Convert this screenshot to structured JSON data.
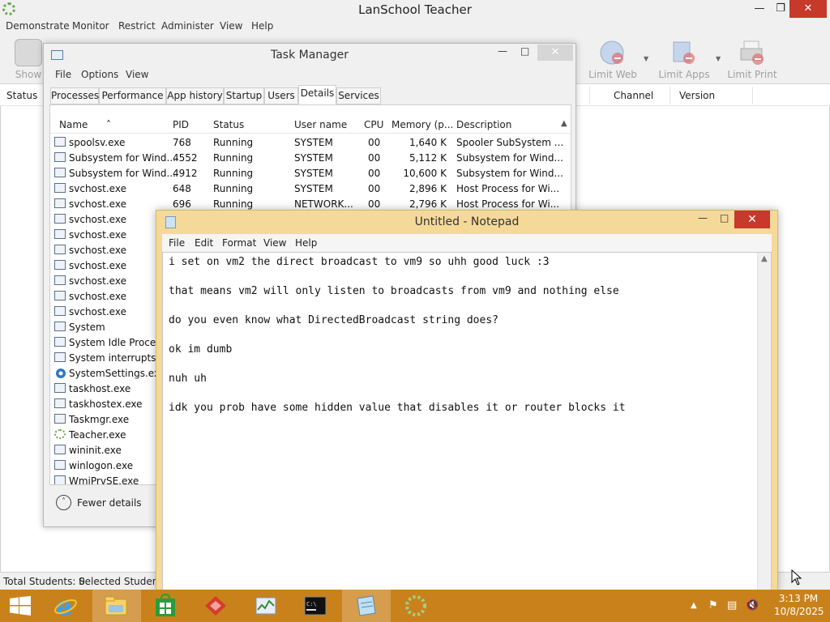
{
  "lanschool": {
    "title": "LanSchool Teacher",
    "menu": [
      "Demonstrate",
      "Monitor",
      "Restrict",
      "Administer",
      "View",
      "Help"
    ],
    "toolbar": {
      "show_label": "Show",
      "limit_web": "Limit Web",
      "limit_apps": "Limit Apps",
      "limit_print": "Limit Print"
    },
    "columns": {
      "status": "Status",
      "channel": "Channel",
      "version": "Version"
    },
    "statusbar": {
      "total": "Total Students: 0",
      "selected": "Selected Students:"
    }
  },
  "taskmgr": {
    "title": "Task Manager",
    "menu": [
      "File",
      "Options",
      "View"
    ],
    "tabs": [
      "Processes",
      "Performance",
      "App history",
      "Startup",
      "Users",
      "Details",
      "Services"
    ],
    "active_tab": "Details",
    "columns": [
      "Name",
      "PID",
      "Status",
      "User name",
      "CPU",
      "Memory (p...",
      "Description"
    ],
    "rows": [
      {
        "name": "spoolsv.exe",
        "pid": "768",
        "status": "Running",
        "user": "SYSTEM",
        "cpu": "00",
        "mem": "1,640 K",
        "desc": "Spooler SubSystem ..."
      },
      {
        "name": "Subsystem for Wind...",
        "pid": "4552",
        "status": "Running",
        "user": "SYSTEM",
        "cpu": "00",
        "mem": "5,112 K",
        "desc": "Subsystem for Wind..."
      },
      {
        "name": "Subsystem for Wind...",
        "pid": "4912",
        "status": "Running",
        "user": "SYSTEM",
        "cpu": "00",
        "mem": "10,600 K",
        "desc": "Subsystem for Wind..."
      },
      {
        "name": "svchost.exe",
        "pid": "648",
        "status": "Running",
        "user": "SYSTEM",
        "cpu": "00",
        "mem": "2,896 K",
        "desc": "Host Process for Wi..."
      },
      {
        "name": "svchost.exe",
        "pid": "696",
        "status": "Running",
        "user": "NETWORK...",
        "cpu": "00",
        "mem": "2,796 K",
        "desc": "Host Process for Wi..."
      },
      {
        "name": "svchost.exe"
      },
      {
        "name": "svchost.exe"
      },
      {
        "name": "svchost.exe"
      },
      {
        "name": "svchost.exe"
      },
      {
        "name": "svchost.exe"
      },
      {
        "name": "svchost.exe"
      },
      {
        "name": "svchost.exe"
      },
      {
        "name": "System"
      },
      {
        "name": "System Idle Process"
      },
      {
        "name": "System interrupts"
      },
      {
        "name": "SystemSettings.exe",
        "icon": "gear-icon"
      },
      {
        "name": "taskhost.exe"
      },
      {
        "name": "taskhostex.exe"
      },
      {
        "name": "Taskmgr.exe"
      },
      {
        "name": "Teacher.exe",
        "icon": "lanschool-icon"
      },
      {
        "name": "wininit.exe"
      },
      {
        "name": "winlogon.exe"
      },
      {
        "name": "WmiPrvSE.exe"
      }
    ],
    "fewer_details": "Fewer details"
  },
  "notepad": {
    "title": "Untitled - Notepad",
    "menu": [
      "File",
      "Edit",
      "Format",
      "View",
      "Help"
    ],
    "lines": [
      "i set on vm2 the direct broadcast to vm9 so uhh good luck :3",
      "",
      "that means vm2 will only listen to broadcasts from vm9 and nothing else",
      "",
      "do you even know what DirectedBroadcast string does?",
      "",
      "ok im dumb",
      "",
      "nuh uh",
      "",
      "idk you prob have some hidden value that disables it or router blocks it"
    ]
  },
  "taskbar": {
    "apps": [
      "internet-explorer-icon",
      "file-explorer-icon",
      "store-icon",
      "lanschool-red-icon",
      "task-manager-icon",
      "command-prompt-icon",
      "notepad-icon",
      "lanschool-teacher-icon"
    ],
    "time": "3:13 PM",
    "date": "10/8/2025"
  },
  "colors": {
    "taskbar": "#c9821b",
    "notepad_frame": "#f5d998",
    "close_red": "#c7392a"
  }
}
